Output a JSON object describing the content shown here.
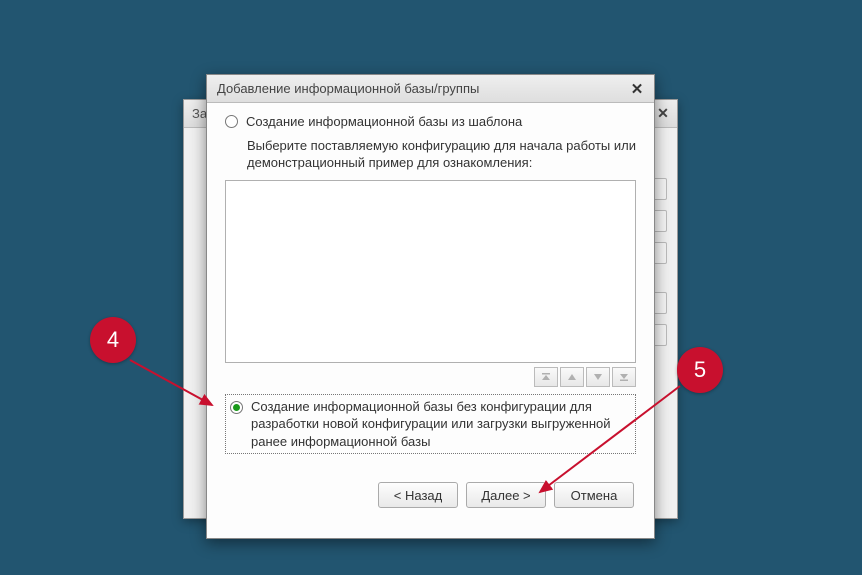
{
  "bg_window": {
    "title_fragment": "За"
  },
  "dialog": {
    "title": "Добавление информационной базы/группы",
    "option1": {
      "label": "Создание информационной базы из шаблона",
      "desc": "Выберите поставляемую конфигурацию для начала работы или демонстрационный пример для ознакомления:"
    },
    "option2": {
      "label": "Создание информационной базы без конфигурации для разработки новой конфигурации или загрузки выгруженной ранее информационной базы"
    },
    "buttons": {
      "back": "< Назад",
      "next": "Далее >",
      "cancel": "Отмена"
    }
  },
  "callouts": {
    "c4": "4",
    "c5": "5"
  }
}
